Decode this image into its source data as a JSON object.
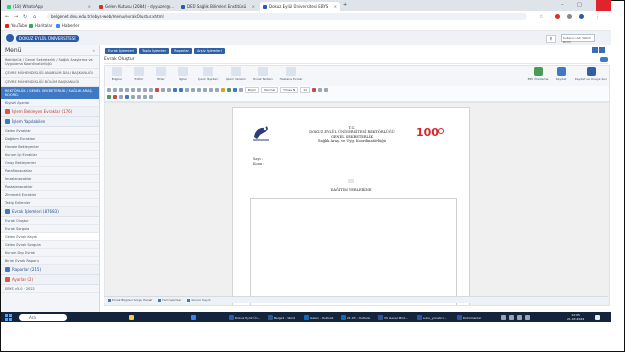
{
  "browser": {
    "tabs": [
      {
        "label": "(18) WhatsApp",
        "color": "#25d366"
      },
      {
        "label": "Gelen Kutusu (2084) - dyyuzer@...",
        "color": "#d93025"
      },
      {
        "label": "DEÜ Sağlık Bilimleri Enstitüsü",
        "color": "#2a5aa8"
      },
      {
        "label": "Dokuz Eylül Üniversitesi EBYS",
        "color": "#2a5aa8"
      }
    ],
    "url": "belgenet.deu.edu.tr/ebys-web/menu/evrakOlustur.xhtml",
    "bookmarks": [
      {
        "label": "YouTube",
        "color": "#e62117"
      },
      {
        "label": "Haritalar",
        "color": "#34a853"
      },
      {
        "label": "Haberler",
        "color": "#4285f4"
      }
    ]
  },
  "app": {
    "logo_text": "DOKUZ EYLÜL ÜNİVERSİTESİ",
    "user_text": "Kullanıcı Adı\nYetkili Birim"
  },
  "sidebar": {
    "menu_title": "Menü",
    "unit_lines": [
      "Rektörlük / Genel Sekreterlik / Sağlık Araştırma ve Uygulama Koordinatörlüğü",
      "ÇEVRE MÜHENDİSLİĞİ ANABİLİM DALI BAŞKANLIĞI",
      "ÇEVRE MÜHENDİSLİĞİ BÖLÜM BAŞKANLIĞI"
    ],
    "active_unit": "REKTÖRLÜK / GENEL SEKRETERLİK / SAĞLIK ARAŞ. KOORD.",
    "kisisel": "Kişisel Ayarlar",
    "sections": [
      {
        "label": "İşlem Bekleyen Evraklar (176)",
        "items": []
      },
      {
        "label": "İşlem Yapılabilen",
        "items": [
          "Gelen Evraklar",
          "Dağıtım Evrakları",
          "Havale Bekleyenler",
          "Kurum İçi Evraklar",
          "Onay Bekleyenler",
          "Paraflanacaklar",
          "İmzalanacaklar",
          "Postalanacaklar",
          "Zimmetli Evraklar",
          "Takip Edilenler"
        ]
      },
      {
        "label": "Evrak İşlemleri (87683)",
        "items": [
          "Evrak Oluştur",
          "Evrak Sorgula",
          "Gelen Evrak Kaydı",
          "Gelen Evrak Sorgula",
          "Kurum Dışı Evrak",
          "Birim Evrak Raporu"
        ]
      },
      {
        "label": "Raporlar (215)",
        "items": []
      },
      {
        "label": "Ayarlar (2)",
        "items": []
      }
    ],
    "version": "EBYS v5.0 · 2022"
  },
  "main": {
    "top_buttons": [
      "Evrak İşlemleri",
      "Toplu İşlemler",
      "Raporlar",
      "Arşiv İşlemleri"
    ],
    "form_title": "Evrak Oluştur",
    "ribbon_left": [
      "Bilgiler",
      "Editör",
      "Ekler",
      "İlgiler",
      "İçerik İlişkileri",
      "İşlem Yazılımı",
      "Evrak Notları",
      "Hastane Evrakı"
    ],
    "ribbon_right": [
      "EBY Önizleme",
      "Kaydet",
      "Kaydet ve Onaya Sun"
    ],
    "format_styles": "Biçim",
    "format_paragraph": "Normal",
    "format_font": "Times N",
    "format_size": "12",
    "document": {
      "header_lines": [
        "T.C.",
        "DOKUZ EYLÜL ÜNİVERSİTESİ REKTÖRLÜĞÜ",
        "GENEL SEKRETERLİK",
        "Sağlık Araş. ve Uyg. Koordinatörlüğü"
      ],
      "sayi_label": "Sayı :",
      "konu_label": "Konu :",
      "dagitim": "DAĞITIM YERLERİNE"
    },
    "status_tabs": [
      "Evrak Bilgileri Sorgu Paneli",
      "Hızlı İşlemler",
      "Kurum Kaydı"
    ]
  },
  "taskbar": {
    "search_placeholder": "Ara",
    "apps": [
      {
        "label": "",
        "color": "#f2c94c"
      },
      {
        "label": "",
        "color": "#3b82f6"
      },
      {
        "label": "Dokuz Eylül Ün...",
        "color": "#2a5aa8"
      },
      {
        "label": "Belge1 - Word",
        "color": "#2b579a"
      },
      {
        "label": "Gelen - Outlook",
        "color": "#0f6cbd"
      },
      {
        "label": "21.03 - Outlook",
        "color": "#0f6cbd"
      },
      {
        "label": "VS Genel Müd...",
        "color": "#2b579a"
      },
      {
        "label": "sunu_yonetici...",
        "color": "#2b579a"
      },
      {
        "label": "Dokümanlar",
        "color": "#2b579a"
      }
    ],
    "time": "12:05",
    "date": "21.03.2024"
  }
}
